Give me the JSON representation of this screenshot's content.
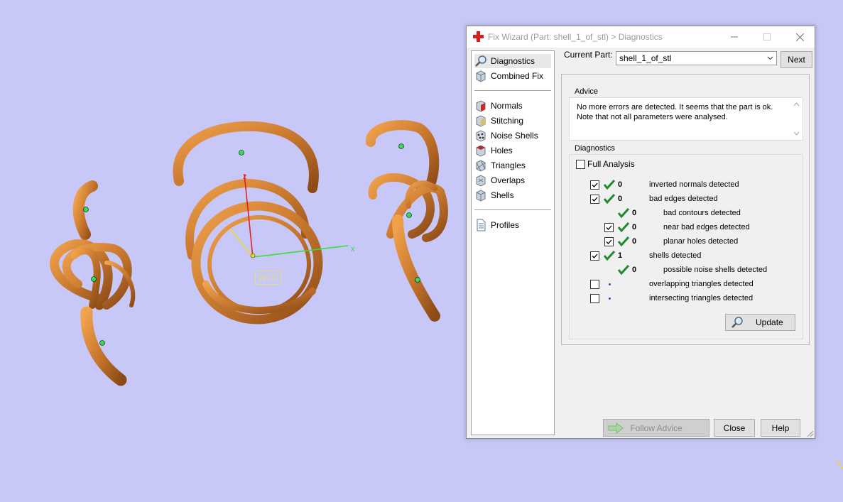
{
  "viewport": {
    "wcs_label": "WCS",
    "axis_labels": {
      "x": "x",
      "z": "z"
    },
    "colors": {
      "background": "#c8c8f8",
      "part": "#c8782e",
      "x_axis": "#33e033",
      "y_axis": "#e6dc28",
      "z_axis": "#e02020"
    }
  },
  "dialog": {
    "title": "Fix Wizard (Part: shell_1_of_stl) > Diagnostics",
    "icons": {
      "app": "red-cross-icon",
      "minimize": "minimize-icon",
      "maximize": "maximize-icon",
      "close": "close-icon"
    },
    "nav": {
      "items": [
        {
          "label": "Diagnostics",
          "icon": "magnifier-icon",
          "selected": true
        },
        {
          "label": "Combined Fix",
          "icon": "combined-fix-icon"
        },
        {
          "label": "Normals",
          "icon": "normals-icon"
        },
        {
          "label": "Stitching",
          "icon": "stitching-icon"
        },
        {
          "label": "Noise Shells",
          "icon": "noise-shells-icon"
        },
        {
          "label": "Holes",
          "icon": "holes-icon"
        },
        {
          "label": "Triangles",
          "icon": "triangles-icon"
        },
        {
          "label": "Overlaps",
          "icon": "overlaps-icon"
        },
        {
          "label": "Shells",
          "icon": "shells-icon"
        },
        {
          "label": "Profiles",
          "icon": "profiles-icon"
        }
      ]
    },
    "current_part": {
      "label": "Current Part:",
      "value": "shell_1_of_stl"
    },
    "next_label": "Next",
    "advice": {
      "title": "Advice",
      "text_line1": "No more errors are detected. It seems that the part is ok.",
      "text_line2": "Note that not all parameters were analysed."
    },
    "diagnostics": {
      "title": "Diagnostics",
      "full_analysis_label": "Full Analysis",
      "full_analysis_checked": false,
      "rows": [
        {
          "label": "inverted normals detected",
          "count": "0",
          "checked": true,
          "status": "ok"
        },
        {
          "label": "bad edges detected",
          "count": "0",
          "checked": true,
          "status": "ok"
        },
        {
          "label": "bad contours detected",
          "count": "0",
          "status": "ok"
        },
        {
          "label": "near bad edges detected",
          "count": "0",
          "checked": true,
          "status": "ok"
        },
        {
          "label": "planar holes detected",
          "count": "0",
          "checked": true,
          "status": "ok"
        },
        {
          "label": "shells detected",
          "count": "1",
          "checked": true,
          "status": "ok"
        },
        {
          "label": "possible noise shells detected",
          "count": "0",
          "status": "ok"
        },
        {
          "label": "overlapping triangles detected",
          "checked": false,
          "status": "not-analysed"
        },
        {
          "label": "intersecting triangles detected",
          "checked": false,
          "status": "not-analysed"
        }
      ],
      "update_label": "Update"
    },
    "footer": {
      "follow_advice_label": "Follow Advice",
      "close_label": "Close",
      "help_label": "Help"
    }
  }
}
